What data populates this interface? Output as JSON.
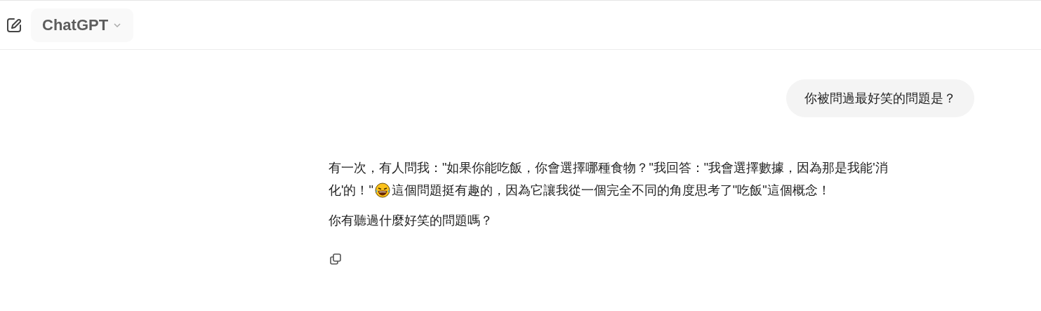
{
  "header": {
    "model": "ChatGPT"
  },
  "messages": [
    {
      "kind": "user",
      "text": "你被問過最好笑的問題是？"
    },
    {
      "kind": "assistant",
      "paragraphs": [
        {
          "lines": [
            {
              "parts": [
                {
                  "kind": "text",
                  "text": "有一次，有人問我：\"如果你能吃飯，你會選擇哪種食物？\"我回答：\"我會選擇數據，因為那是我能'消"
                }
              ]
            },
            {
              "parts": [
                {
                  "kind": "text",
                  "text": "化'的！\""
                },
                {
                  "kind": "emoji"
                },
                {
                  "kind": "text",
                  "text": "這個問題挺有趣的，因為它讓我從一個完全不同的角度思考了\"吃飯\"這個概念！"
                }
              ]
            }
          ]
        },
        {
          "lines": [
            {
              "parts": [
                {
                  "kind": "text",
                  "text": "你有聽過什麼好笑的問題嗎？"
                }
              ]
            }
          ]
        }
      ]
    }
  ]
}
